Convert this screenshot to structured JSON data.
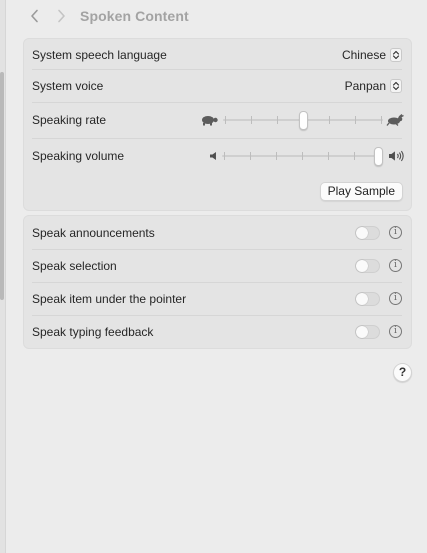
{
  "header": {
    "title": "Spoken Content"
  },
  "speech": {
    "language_label": "System speech language",
    "language_value": "Chinese",
    "voice_label": "System voice",
    "voice_value": "Panpan",
    "rate_label": "Speaking rate",
    "rate_level": 0.5,
    "volume_label": "Speaking volume",
    "volume_level": 1.0,
    "play_sample_label": "Play Sample"
  },
  "options": [
    {
      "label": "Speak announcements",
      "enabled": false
    },
    {
      "label": "Speak selection",
      "enabled": false
    },
    {
      "label": "Speak item under the pointer",
      "enabled": false
    },
    {
      "label": "Speak typing feedback",
      "enabled": false
    }
  ],
  "help": {
    "label": "?"
  },
  "icons": {
    "back": "chevron-left-icon",
    "forward": "chevron-right-icon",
    "rate_min": "turtle-icon",
    "rate_max": "hare-icon",
    "volume_min": "speaker-low-icon",
    "volume_max": "speaker-high-icon",
    "info": "info-icon"
  }
}
